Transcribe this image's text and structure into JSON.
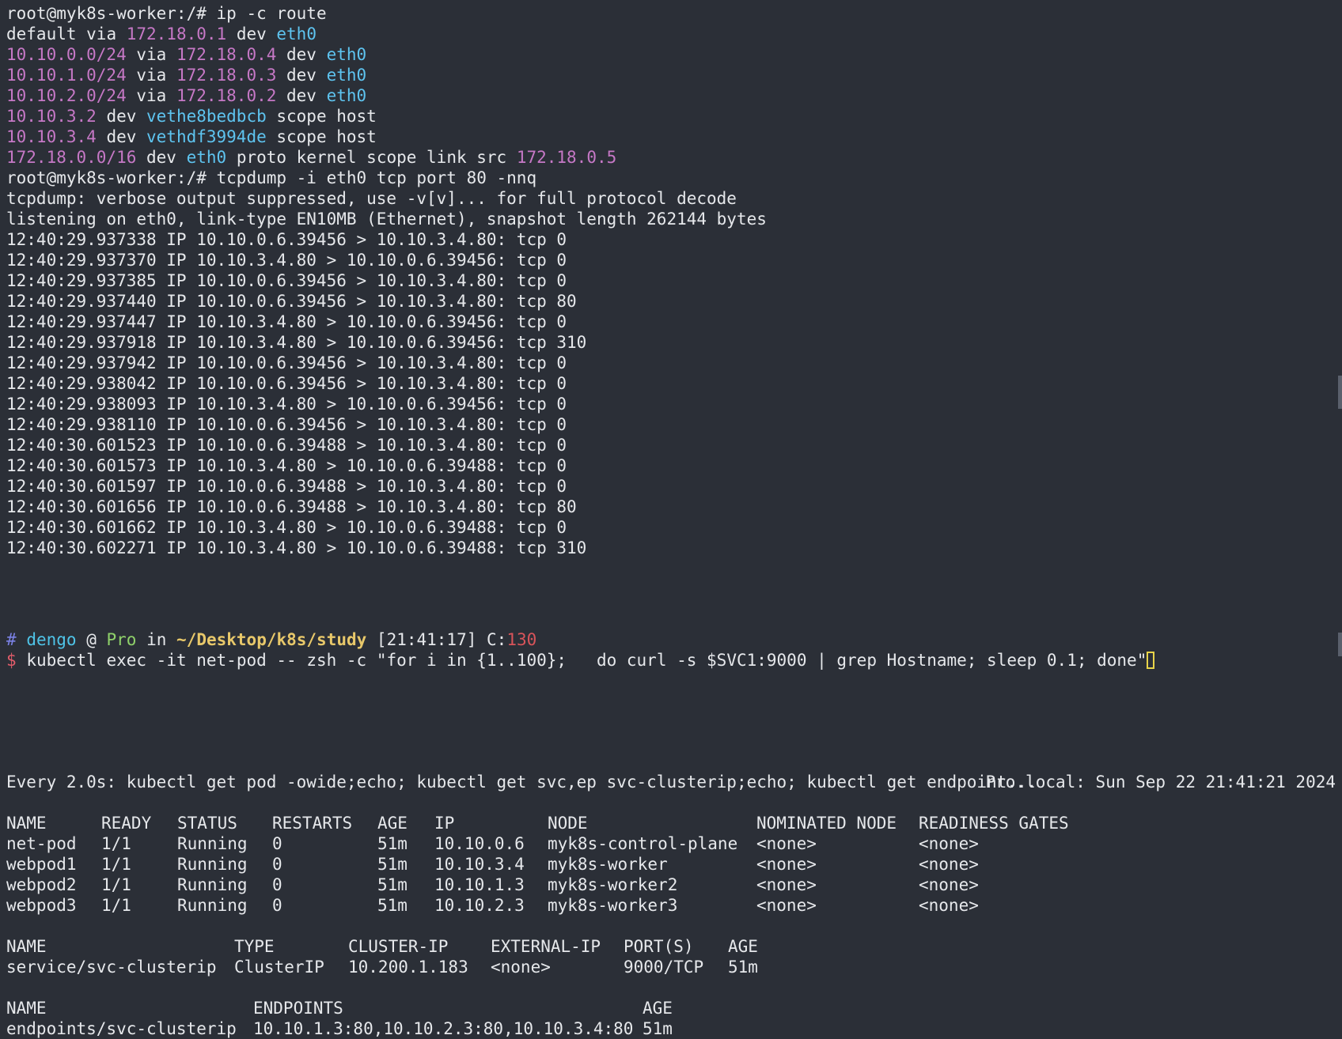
{
  "top_pane": {
    "prompt1": "root@myk8s-worker:/# ",
    "cmd1": "ip -c route",
    "routes": [
      {
        "dest": "default",
        "via": "172.18.0.1",
        "dev": "eth0",
        "tail": ""
      },
      {
        "dest": "10.10.0.0/24",
        "via": "172.18.0.4",
        "dev": "eth0",
        "tail": ""
      },
      {
        "dest": "10.10.1.0/24",
        "via": "172.18.0.3",
        "dev": "eth0",
        "tail": ""
      },
      {
        "dest": "10.10.2.0/24",
        "via": "172.18.0.2",
        "dev": "eth0",
        "tail": ""
      }
    ],
    "host_routes": [
      {
        "dest": "10.10.3.2",
        "dev": "vethe8bedbcb",
        "tail": " scope host"
      },
      {
        "dest": "10.10.3.4",
        "dev": "vethdf3994de",
        "tail": " scope host"
      }
    ],
    "link_route": {
      "dest": "172.18.0.0/16",
      "dev": "eth0",
      "mid": " proto kernel scope link src ",
      "src": "172.18.0.5"
    },
    "prompt2": "root@myk8s-worker:/# ",
    "cmd2": "tcpdump -i eth0 tcp port 80 -nnq",
    "info1": "tcpdump: verbose output suppressed, use -v[v]... for full protocol decode",
    "info2": "listening on eth0, link-type EN10MB (Ethernet), snapshot length 262144 bytes",
    "packets": [
      "12:40:29.937338 IP 10.10.0.6.39456 > 10.10.3.4.80: tcp 0",
      "12:40:29.937370 IP 10.10.3.4.80 > 10.10.0.6.39456: tcp 0",
      "12:40:29.937385 IP 10.10.0.6.39456 > 10.10.3.4.80: tcp 0",
      "12:40:29.937440 IP 10.10.0.6.39456 > 10.10.3.4.80: tcp 80",
      "12:40:29.937447 IP 10.10.3.4.80 > 10.10.0.6.39456: tcp 0",
      "12:40:29.937918 IP 10.10.3.4.80 > 10.10.0.6.39456: tcp 310",
      "12:40:29.937942 IP 10.10.0.6.39456 > 10.10.3.4.80: tcp 0",
      "12:40:29.938042 IP 10.10.0.6.39456 > 10.10.3.4.80: tcp 0",
      "12:40:29.938093 IP 10.10.3.4.80 > 10.10.0.6.39456: tcp 0",
      "12:40:29.938110 IP 10.10.0.6.39456 > 10.10.3.4.80: tcp 0",
      "12:40:30.601523 IP 10.10.0.6.39488 > 10.10.3.4.80: tcp 0",
      "12:40:30.601573 IP 10.10.3.4.80 > 10.10.0.6.39488: tcp 0",
      "12:40:30.601597 IP 10.10.0.6.39488 > 10.10.3.4.80: tcp 0",
      "12:40:30.601656 IP 10.10.0.6.39488 > 10.10.3.4.80: tcp 80",
      "12:40:30.601662 IP 10.10.3.4.80 > 10.10.0.6.39488: tcp 0",
      "12:40:30.602271 IP 10.10.3.4.80 > 10.10.0.6.39488: tcp 310"
    ]
  },
  "mid_pane": {
    "hash": "#",
    "user": "dengo",
    "at": "@",
    "host": "Pro",
    "in": "in",
    "path": "~/Desktop/k8s/study",
    "time": "[21:41:17]",
    "code_label": "C:",
    "code": "130",
    "dollar": "$",
    "command": "kubectl exec -it net-pod -- zsh -c \"for i in {1..100};   do curl -s $SVC1:9000 | grep Hostname; sleep 0.1; done\""
  },
  "bottom_pane": {
    "watch_cmd": "Every 2.0s: kubectl get pod -owide;echo; kubectl get svc,ep svc-clusterip;echo; kubectl get endpoint...",
    "watch_host": "Pro.local: Sun Sep 22 21:41:21 2024",
    "pods": {
      "headers": [
        "NAME",
        "READY",
        "STATUS",
        "RESTARTS",
        "AGE",
        "IP",
        "NODE",
        "NOMINATED NODE",
        "READINESS GATES"
      ],
      "rows": [
        [
          "net-pod",
          "1/1",
          "Running",
          "0",
          "51m",
          "10.10.0.6",
          "myk8s-control-plane",
          "<none>",
          "<none>"
        ],
        [
          "webpod1",
          "1/1",
          "Running",
          "0",
          "51m",
          "10.10.3.4",
          "myk8s-worker",
          "<none>",
          "<none>"
        ],
        [
          "webpod2",
          "1/1",
          "Running",
          "0",
          "51m",
          "10.10.1.3",
          "myk8s-worker2",
          "<none>",
          "<none>"
        ],
        [
          "webpod3",
          "1/1",
          "Running",
          "0",
          "51m",
          "10.10.2.3",
          "myk8s-worker3",
          "<none>",
          "<none>"
        ]
      ]
    },
    "svc": {
      "headers": [
        "NAME",
        "TYPE",
        "CLUSTER-IP",
        "EXTERNAL-IP",
        "PORT(S)",
        "AGE"
      ],
      "rows": [
        [
          "service/svc-clusterip",
          "ClusterIP",
          "10.200.1.183",
          "<none>",
          "9000/TCP",
          "51m"
        ]
      ]
    },
    "ep": {
      "headers": [
        "NAME",
        "ENDPOINTS",
        "AGE"
      ],
      "rows": [
        [
          "endpoints/svc-clusterip",
          "10.10.1.3:80,10.10.2.3:80,10.10.3.4:80",
          "51m"
        ]
      ]
    }
  }
}
